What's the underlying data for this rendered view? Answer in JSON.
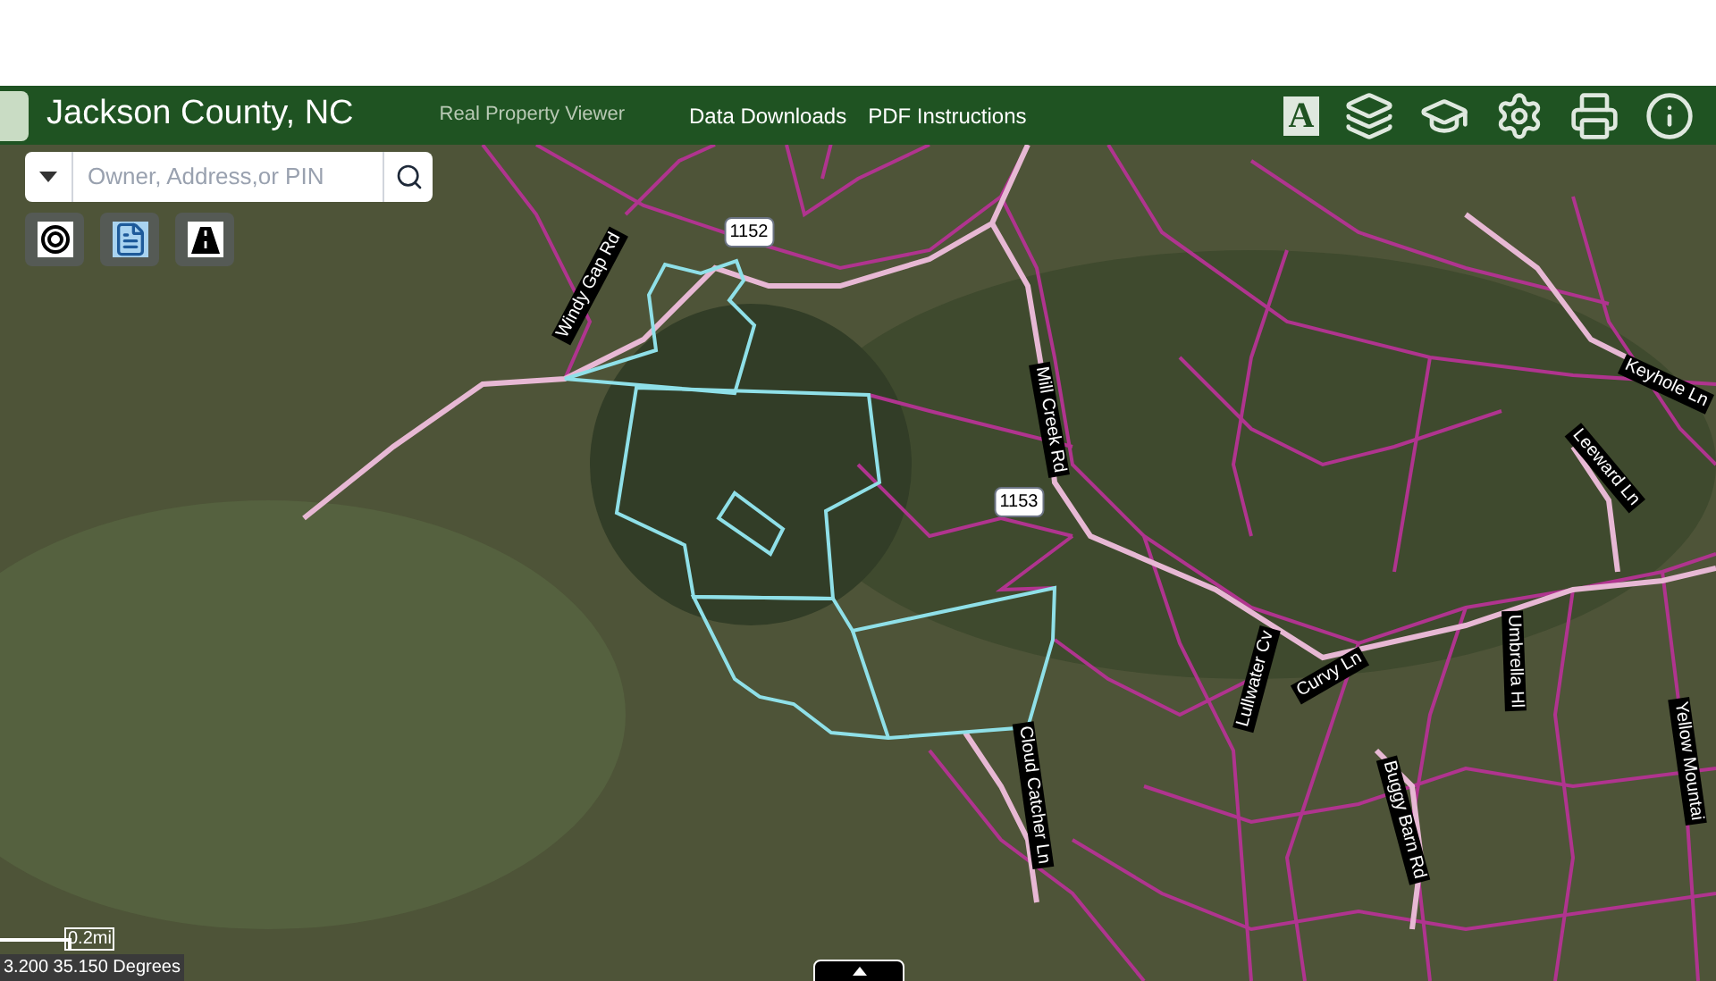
{
  "header": {
    "title": "Jackson County, NC",
    "subtitle": "Real Property Viewer",
    "links": [
      "Data Downloads",
      "PDF Instructions"
    ],
    "text_tool": "A"
  },
  "search": {
    "placeholder": "Owner, Address,or PIN"
  },
  "map": {
    "road_labels": [
      {
        "kind": "road",
        "text": "Windy Gap Rd"
      },
      {
        "kind": "shield",
        "text": "1152"
      },
      {
        "kind": "road",
        "text": "Mill Creek Rd"
      },
      {
        "kind": "shield",
        "text": "1153"
      },
      {
        "kind": "road",
        "text": "Keyhole Ln"
      },
      {
        "kind": "road",
        "text": "Leeward Ln"
      },
      {
        "kind": "road",
        "text": "Cloud Catcher Ln"
      },
      {
        "kind": "road",
        "text": "Lullwater Cv"
      },
      {
        "kind": "road",
        "text": "Curvy Ln"
      },
      {
        "kind": "road",
        "text": "Buggy Barn Rd"
      },
      {
        "kind": "road",
        "text": "Umbrella Hl"
      },
      {
        "kind": "road",
        "text": "Yellow Mountai"
      }
    ],
    "scale": "0.2mi",
    "coordinates": "3.200 35.150 Degrees"
  }
}
